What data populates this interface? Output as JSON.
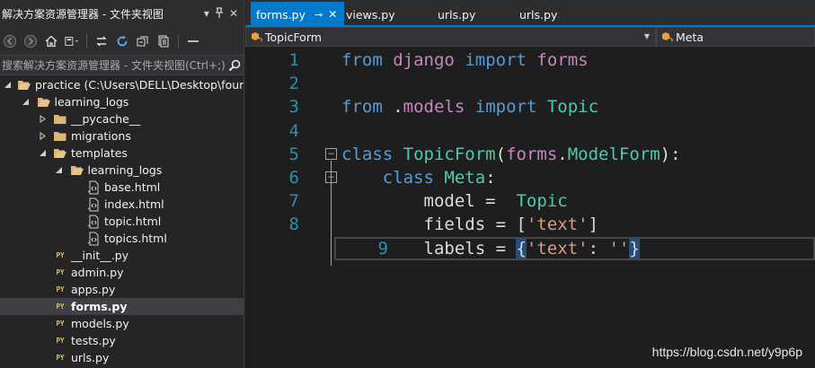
{
  "solution_explorer": {
    "title": "解决方案资源管理器 - 文件夹视图",
    "dropdown_glyph": "▾",
    "pin_glyph": "⊓",
    "close_glyph": "✕",
    "search_placeholder": "搜索解决方案资源管理器 - 文件夹视图(Ctrl+;)",
    "tree": [
      {
        "label": "practice (C:\\Users\\DELL\\Desktop\\four\\l",
        "icon": "folder-open-icon",
        "expander": "expanded",
        "level": 0
      },
      {
        "label": "learning_logs",
        "icon": "folder-open-icon",
        "expander": "expanded",
        "level": 1
      },
      {
        "label": "__pycache__",
        "icon": "folder-icon",
        "expander": "collapsed",
        "level": 2
      },
      {
        "label": "migrations",
        "icon": "folder-icon",
        "expander": "collapsed",
        "level": 2
      },
      {
        "label": "templates",
        "icon": "folder-open-icon",
        "expander": "expanded",
        "level": 2
      },
      {
        "label": "learning_logs",
        "icon": "folder-open-icon",
        "expander": "expanded",
        "level": 3
      },
      {
        "label": "base.html",
        "icon": "html-file-icon",
        "expander": "none",
        "level": 4
      },
      {
        "label": "index.html",
        "icon": "html-file-icon",
        "expander": "none",
        "level": 4
      },
      {
        "label": "topic.html",
        "icon": "html-file-icon",
        "expander": "none",
        "level": 4
      },
      {
        "label": "topics.html",
        "icon": "html-file-icon",
        "expander": "none",
        "level": 4
      },
      {
        "label": "__init__.py",
        "icon": "python-file-icon",
        "expander": "none",
        "level": 2
      },
      {
        "label": "admin.py",
        "icon": "python-file-icon",
        "expander": "none",
        "level": 2
      },
      {
        "label": "apps.py",
        "icon": "python-file-icon",
        "expander": "none",
        "level": 2
      },
      {
        "label": "forms.py",
        "icon": "python-file-icon",
        "expander": "none",
        "level": 2,
        "selected": true
      },
      {
        "label": "models.py",
        "icon": "python-file-icon",
        "expander": "none",
        "level": 2
      },
      {
        "label": "tests.py",
        "icon": "python-file-icon",
        "expander": "none",
        "level": 2
      },
      {
        "label": "urls.py",
        "icon": "python-file-icon",
        "expander": "none",
        "level": 2
      }
    ],
    "py_badge": "PY"
  },
  "editor": {
    "tabs": [
      {
        "label": "forms.py",
        "active": true
      },
      {
        "label": "views.py",
        "active": false
      },
      {
        "label": "urls.py",
        "active": false
      },
      {
        "label": "urls.py",
        "active": false
      }
    ],
    "active_tab_pin": "⊸",
    "active_tab_close": "✕",
    "nav_left": "TopicForm",
    "nav_right": "Meta",
    "nav_arrow": "▼",
    "fold_minus": "−",
    "lines": [
      {
        "n": "1",
        "fold": false,
        "tokens": [
          [
            "kw",
            "from"
          ],
          [
            "pl",
            " "
          ],
          [
            "md",
            "django"
          ],
          [
            "pl",
            " "
          ],
          [
            "kw",
            "import"
          ],
          [
            "pl",
            " "
          ],
          [
            "md",
            "forms"
          ]
        ]
      },
      {
        "n": "2",
        "fold": false,
        "tokens": []
      },
      {
        "n": "3",
        "fold": false,
        "tokens": [
          [
            "kw",
            "from"
          ],
          [
            "pl",
            " ."
          ],
          [
            "md",
            "models"
          ],
          [
            "pl",
            " "
          ],
          [
            "kw",
            "import"
          ],
          [
            "pl",
            " "
          ],
          [
            "ty",
            "Topic"
          ]
        ]
      },
      {
        "n": "4",
        "fold": false,
        "tokens": []
      },
      {
        "n": "5",
        "fold": true,
        "tokens": [
          [
            "kw",
            "class"
          ],
          [
            "pl",
            " "
          ],
          [
            "ty",
            "TopicForm"
          ],
          [
            "pl",
            "("
          ],
          [
            "md",
            "forms"
          ],
          [
            "pl",
            "."
          ],
          [
            "ty",
            "ModelForm"
          ],
          [
            "pl",
            "):"
          ]
        ]
      },
      {
        "n": "6",
        "fold": true,
        "tokens": [
          [
            "pl",
            "    "
          ],
          [
            "kw",
            "class"
          ],
          [
            "pl",
            " "
          ],
          [
            "ty",
            "Meta"
          ],
          [
            "pl",
            ":"
          ]
        ]
      },
      {
        "n": "7",
        "fold": false,
        "tokens": [
          [
            "pl",
            "        model =  "
          ],
          [
            "ty",
            "Topic"
          ]
        ]
      },
      {
        "n": "8",
        "fold": false,
        "tokens": [
          [
            "pl",
            "        fields = ["
          ],
          [
            "st",
            "'text'"
          ],
          [
            "pl",
            "]"
          ]
        ]
      },
      {
        "n": "9",
        "fold": false,
        "current": true,
        "tokens": [
          [
            "pl",
            "        labels = "
          ],
          [
            "brace",
            "{"
          ],
          [
            "st",
            "'text'"
          ],
          [
            "pl",
            ": "
          ],
          [
            "st",
            "''"
          ],
          [
            "brace",
            "}"
          ]
        ]
      }
    ]
  },
  "watermark": "https://blog.csdn.net/y9p6p",
  "colors": {
    "accent": "#007acc",
    "keyword": "#569cd6",
    "type": "#4ec9b0",
    "module": "#c586c0",
    "string": "#d69d85",
    "line_number": "#2b91af"
  }
}
